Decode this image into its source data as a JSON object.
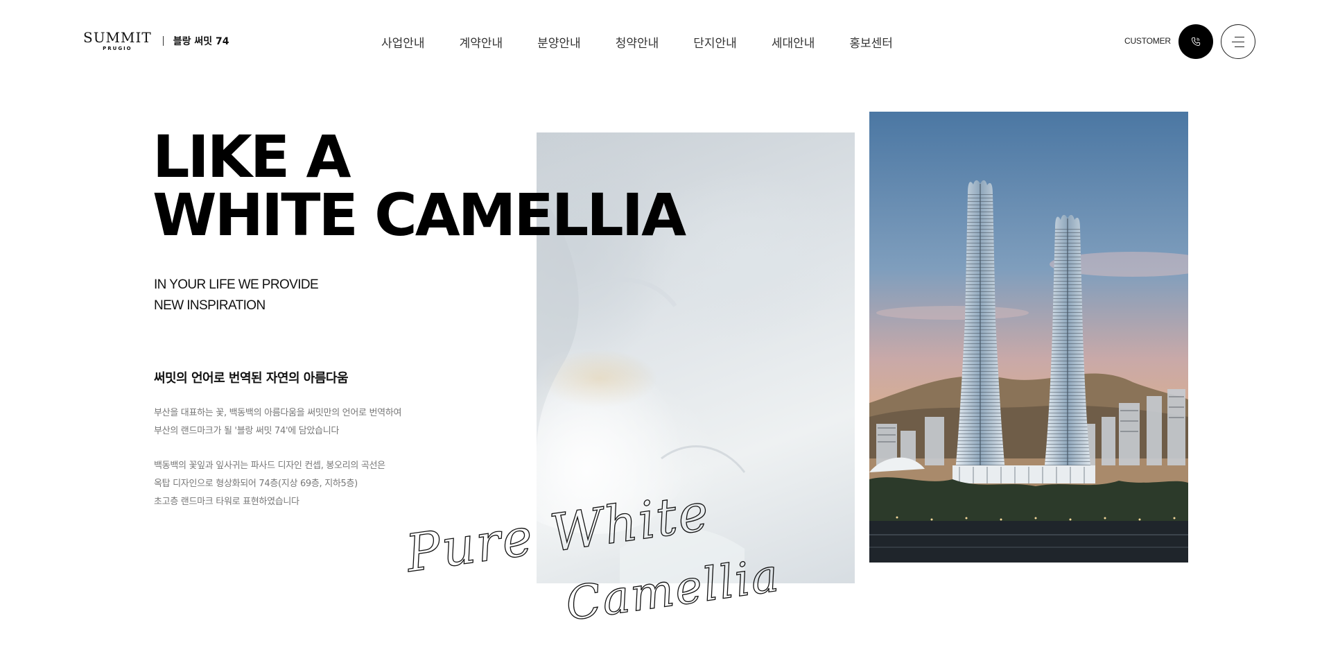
{
  "header": {
    "logo": {
      "brand": "SUMMIT",
      "sub": "PRUGIO",
      "name": "블랑 써밋 74"
    },
    "nav": [
      "사업안내",
      "계약안내",
      "분양안내",
      "청약안내",
      "단지안내",
      "세대안내",
      "홍보센터"
    ],
    "customer_label": "CUSTOMER",
    "icons": {
      "call": "phone-icon",
      "menu": "hamburger-icon"
    }
  },
  "hero": {
    "title_line1": "LIKE A",
    "title_line2": "WHITE CAMELLIA",
    "subtitle_line1": "IN YOUR LIFE WE PROVIDE",
    "subtitle_line2": "NEW INSPIRATION",
    "heading": "써밋의 언어로 번역된 자연의 아름다움",
    "para1": [
      "부산을 대표하는 꽃, 백동백의 아름다움을 써밋만의 언어로 번역하여",
      "부산의 랜드마크가 될 '블랑 써밋 74'에 담았습니다"
    ],
    "para2": [
      "백동백의 꽃잎과 잎사귀는 파사드 디자인 컨셉, 봉오리의 곡선은",
      "옥탑 디자인으로 형상화되어 74층(지상 69층, 지하5층)",
      "초고층 랜드마크 타워로 표현하였습니다"
    ],
    "script_line1": "Pure White",
    "script_line2": "Camellia"
  },
  "colors": {
    "accent": "#000000",
    "text_muted": "#777777",
    "sky_top": "#4e7aa6"
  }
}
